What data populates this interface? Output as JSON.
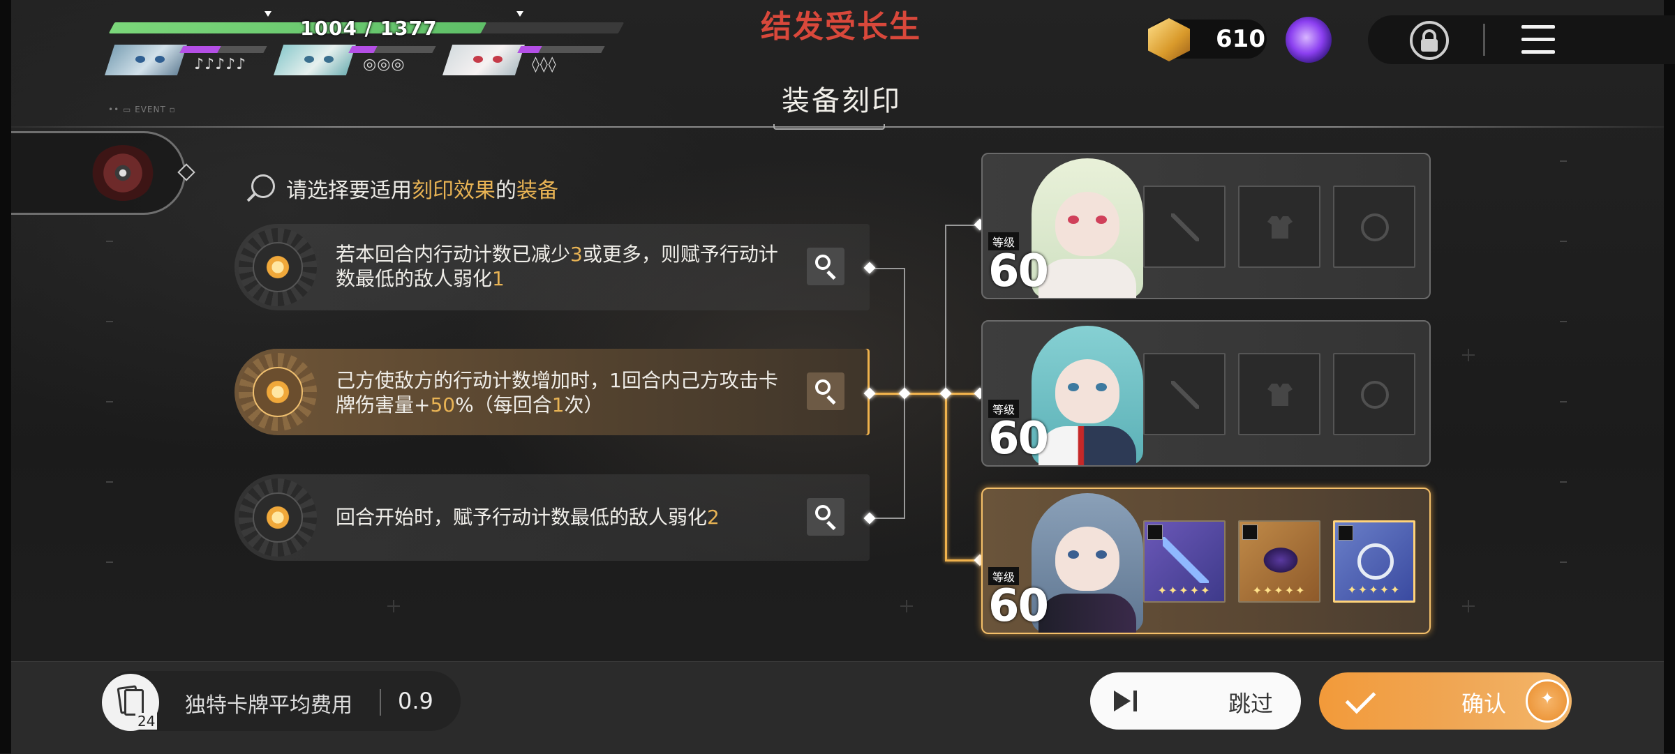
{
  "hud": {
    "hp_text": "1004 / 1377",
    "hp_fraction": 0.73,
    "members": [
      {
        "name": "party-member-1",
        "pips": "♪♪♪♪♪",
        "energy_fraction": 0.45
      },
      {
        "name": "party-member-2",
        "pips": "◎◎◎",
        "energy_fraction": 0.3
      },
      {
        "name": "party-member-3",
        "pips": "◊◊◊",
        "energy_fraction": 0.25
      }
    ]
  },
  "top": {
    "title": "结发受长生",
    "currency_value": "610",
    "icons": [
      "gem-icon",
      "orb-icon",
      "lock-icon",
      "menu-icon"
    ]
  },
  "header": {
    "title": "装备刻印",
    "small_tag": "•• ▭ EVENT ▫"
  },
  "prompt": {
    "pre": "请选择要适用",
    "hl1": "刻印效果",
    "mid": "的",
    "hl2": "装备"
  },
  "effects": [
    {
      "line1_a": "若本回合内行动计数已减少",
      "line1_num": "3",
      "line1_b": "或更多，则赋予行动计",
      "line2_a": "数最低的敌人弱化",
      "line2_num": "1",
      "line2_b": "",
      "line2_num2": "",
      "line2_c": "",
      "selected": false
    },
    {
      "line1_a": "己方使敌方的行动计数增加时，1回合内己方攻击卡",
      "line1_num": "",
      "line1_b": "",
      "line2_a": "牌伤害量+",
      "line2_num": "50",
      "line2_b": "%（每回合",
      "line2_num2": "1",
      "line2_c": "次）",
      "selected": true
    },
    {
      "line1_a": "回合开始时，赋予行动计数最低的敌人弱化",
      "line1_num": "2",
      "line1_b": "",
      "line2_a": "",
      "line2_num": "",
      "line2_b": "",
      "line2_num2": "",
      "line2_c": "",
      "selected": false
    }
  ],
  "characters": [
    {
      "level_label": "等级",
      "level": "60",
      "slots": [
        "sword",
        "armor",
        "ring"
      ],
      "filled": false
    },
    {
      "level_label": "等级",
      "level": "60",
      "slots": [
        "sword",
        "armor",
        "ring"
      ],
      "filled": false
    },
    {
      "level_label": "等级",
      "level": "60",
      "slots": [
        "sword",
        "armor",
        "ring"
      ],
      "filled": true,
      "stars": "✦✦✦✦✦"
    }
  ],
  "bottom": {
    "deck_count": "24",
    "deck_label": "独特卡牌平均费用",
    "deck_value": "0.9",
    "skip_label": "跳过",
    "confirm_label": "确认"
  },
  "colors": {
    "accent_gold": "#e8b354",
    "title_red": "#d9483b",
    "hp_green": "#6fcf72",
    "energy_purple": "#b44fe6",
    "confirm_orange": "#f0a857"
  }
}
